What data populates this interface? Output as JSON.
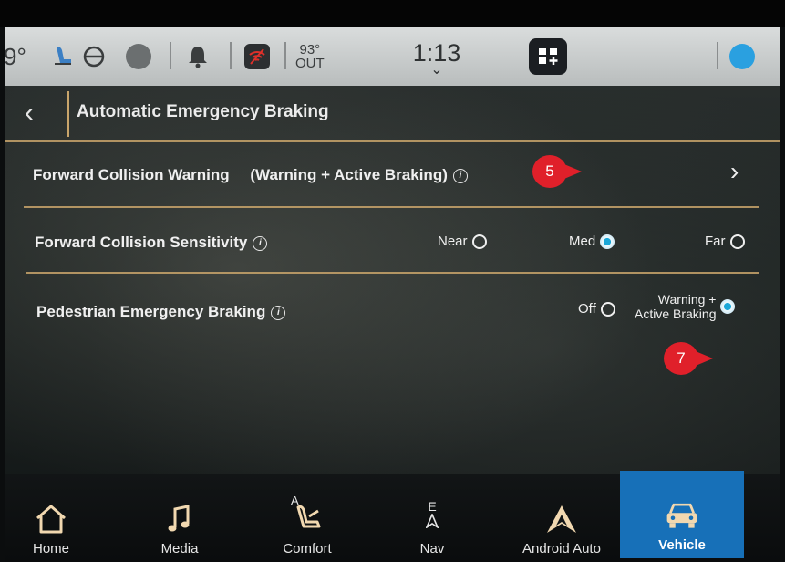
{
  "statusbar": {
    "temp_left": "9°",
    "outside_temp": "93°",
    "outside_label": "OUT",
    "time": "1:13",
    "time_chevron": "⌄"
  },
  "header": {
    "back_glyph": "‹",
    "title": "Automatic Emergency Braking"
  },
  "rows": {
    "fcw": {
      "label": "Forward Collision Warning",
      "value": "(Warning + Active Braking)",
      "chevron": "›"
    },
    "sensitivity": {
      "label": "Forward Collision Sensitivity",
      "options": [
        {
          "label": "Near",
          "selected": false
        },
        {
          "label": "Med",
          "selected": true
        },
        {
          "label": "Far",
          "selected": false
        }
      ]
    },
    "pedestrian": {
      "label": "Pedestrian Emergency Braking",
      "options": [
        {
          "label": "Off",
          "selected": false
        },
        {
          "label_line1": "Warning +",
          "label_line2": "Active Braking",
          "selected": true
        }
      ]
    }
  },
  "annotations": [
    {
      "text": "5"
    },
    {
      "text": "7"
    }
  ],
  "navbar": {
    "items": [
      {
        "label": "Home",
        "icon": "home-icon"
      },
      {
        "label": "Media",
        "icon": "music-note-icon"
      },
      {
        "label": "Comfort",
        "icon": "seat-icon",
        "letter": "A"
      },
      {
        "label": "Nav",
        "icon": "compass-icon",
        "letter": "E"
      },
      {
        "label": "Android Auto",
        "icon": "android-auto-icon"
      },
      {
        "label": "Vehicle",
        "icon": "vehicle-icon",
        "active": true
      }
    ]
  },
  "colors": {
    "accent_gold": "#c9a56b",
    "active_blue": "#1770b8",
    "radio_on": "#1aa7d8",
    "callout_red": "#e0202a"
  }
}
